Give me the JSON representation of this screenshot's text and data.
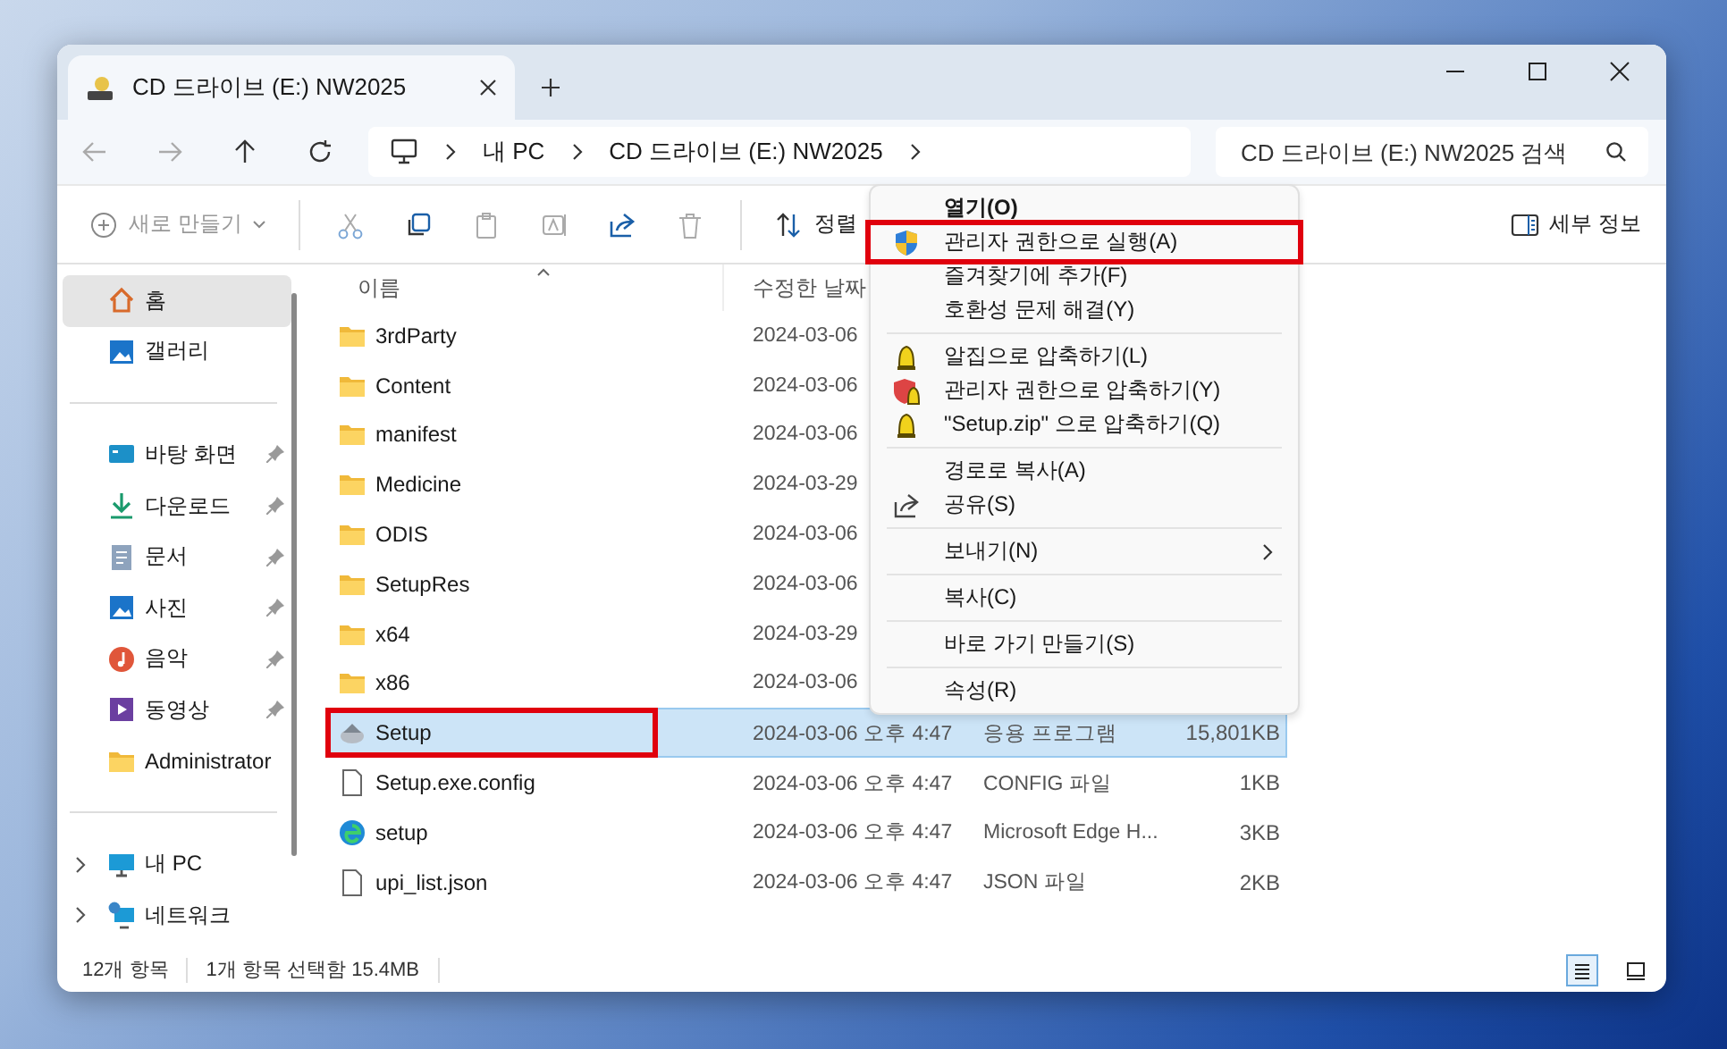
{
  "window": {
    "tab_title": "CD 드라이브 (E:) NW2025"
  },
  "address_bar": {
    "crumbs": [
      "내 PC",
      "CD 드라이브 (E:) NW2025"
    ],
    "search_placeholder": "CD 드라이브 (E:) NW2025 검색"
  },
  "command_bar": {
    "new_label": "새로 만들기",
    "new_disabled": true,
    "sort_label": "정렬",
    "details_label": "세부 정보"
  },
  "sidebar": {
    "groups": [
      [
        {
          "label": "홈",
          "kind": "home",
          "selected": true,
          "pinned": false,
          "expandable": false
        },
        {
          "label": "갤러리",
          "kind": "gallery",
          "selected": false,
          "pinned": false,
          "expandable": false
        }
      ],
      [
        {
          "label": "바탕 화면",
          "kind": "desktop",
          "selected": false,
          "pinned": true,
          "expandable": false
        },
        {
          "label": "다운로드",
          "kind": "download",
          "selected": false,
          "pinned": true,
          "expandable": false
        },
        {
          "label": "문서",
          "kind": "document",
          "selected": false,
          "pinned": true,
          "expandable": false
        },
        {
          "label": "사진",
          "kind": "gallery",
          "selected": false,
          "pinned": true,
          "expandable": false
        },
        {
          "label": "음악",
          "kind": "music",
          "selected": false,
          "pinned": true,
          "expandable": false
        },
        {
          "label": "동영상",
          "kind": "video",
          "selected": false,
          "pinned": true,
          "expandable": false
        },
        {
          "label": "Administrator",
          "kind": "folder",
          "selected": false,
          "pinned": false,
          "expandable": false
        }
      ],
      [
        {
          "label": "내 PC",
          "kind": "monitor",
          "selected": false,
          "pinned": false,
          "expandable": true
        },
        {
          "label": "네트워크",
          "kind": "network",
          "selected": false,
          "pinned": false,
          "expandable": true
        }
      ]
    ]
  },
  "file_list": {
    "columns": [
      {
        "label": "이름",
        "sorted": true
      },
      {
        "label": "수정한 날짜",
        "sorted": false
      }
    ],
    "rows": [
      {
        "name": "3rdParty",
        "kind": "folder",
        "date": "2024-03-06",
        "selected": false,
        "highlighted": false
      },
      {
        "name": "Content",
        "kind": "folder",
        "date": "2024-03-06",
        "selected": false,
        "highlighted": false
      },
      {
        "name": "manifest",
        "kind": "folder",
        "date": "2024-03-06",
        "selected": false,
        "highlighted": false
      },
      {
        "name": "Medicine",
        "kind": "folder",
        "date": "2024-03-29",
        "selected": false,
        "highlighted": false
      },
      {
        "name": "ODIS",
        "kind": "folder",
        "date": "2024-03-06",
        "selected": false,
        "highlighted": false
      },
      {
        "name": "SetupRes",
        "kind": "folder",
        "date": "2024-03-06",
        "selected": false,
        "highlighted": false
      },
      {
        "name": "x64",
        "kind": "folder",
        "date": "2024-03-29",
        "selected": false,
        "highlighted": false
      },
      {
        "name": "x86",
        "kind": "folder",
        "date": "2024-03-06",
        "selected": false,
        "highlighted": false
      },
      {
        "name": "Setup",
        "kind": "installer",
        "date": "2024-03-06 오후 4:47",
        "type": "응용 프로그램",
        "size": "15,801KB",
        "selected": true,
        "highlighted": true
      },
      {
        "name": "Setup.exe.config",
        "kind": "file",
        "date": "2024-03-06 오후 4:47",
        "type": "CONFIG 파일",
        "size": "1KB",
        "selected": false,
        "highlighted": false
      },
      {
        "name": "setup",
        "kind": "edge",
        "date": "2024-03-06 오후 4:47",
        "type": "Microsoft Edge H...",
        "size": "3KB",
        "selected": false,
        "highlighted": false
      },
      {
        "name": "upi_list.json",
        "kind": "file",
        "date": "2024-03-06 오후 4:47",
        "type": "JSON 파일",
        "size": "2KB",
        "selected": false,
        "highlighted": false
      }
    ]
  },
  "context_menu": {
    "items": [
      {
        "kind": "plain",
        "label": "열기(O)",
        "default": true,
        "highlighted": false,
        "submenu": false
      },
      {
        "kind": "shield",
        "label": "관리자 권한으로 실행(A)",
        "default": false,
        "highlighted": true,
        "submenu": false
      },
      {
        "kind": "plain",
        "label": "즐겨찾기에 추가(F)",
        "default": false,
        "highlighted": false,
        "submenu": false
      },
      {
        "kind": "plain",
        "label": "호환성 문제 해결(Y)",
        "default": false,
        "highlighted": false,
        "submenu": false
      },
      {
        "kind": "separator"
      },
      {
        "kind": "zip",
        "label": "알집으로 압축하기(L)",
        "default": false,
        "highlighted": false,
        "submenu": false
      },
      {
        "kind": "shield-zip",
        "label": "관리자 권한으로 압축하기(Y)",
        "default": false,
        "highlighted": false,
        "submenu": false
      },
      {
        "kind": "zip",
        "label": "\"Setup.zip\" 으로 압축하기(Q)",
        "default": false,
        "highlighted": false,
        "submenu": false
      },
      {
        "kind": "separator"
      },
      {
        "kind": "plain",
        "label": "경로로 복사(A)",
        "default": false,
        "highlighted": false,
        "submenu": false
      },
      {
        "kind": "share",
        "label": "공유(S)",
        "default": false,
        "highlighted": false,
        "submenu": false
      },
      {
        "kind": "separator"
      },
      {
        "kind": "plain",
        "label": "보내기(N)",
        "default": false,
        "highlighted": false,
        "submenu": true
      },
      {
        "kind": "separator"
      },
      {
        "kind": "plain",
        "label": "복사(C)",
        "default": false,
        "highlighted": false,
        "submenu": false
      },
      {
        "kind": "separator"
      },
      {
        "kind": "plain",
        "label": "바로 가기 만들기(S)",
        "default": false,
        "highlighted": false,
        "submenu": false
      },
      {
        "kind": "separator"
      },
      {
        "kind": "plain",
        "label": "속성(R)",
        "default": false,
        "highlighted": false,
        "submenu": false
      }
    ]
  },
  "status_bar": {
    "item_count": "12개 항목",
    "selection": "1개 항목 선택함 15.4MB",
    "views": [
      {
        "kind": "details",
        "selected": true
      },
      {
        "kind": "tiles",
        "selected": false
      }
    ]
  }
}
